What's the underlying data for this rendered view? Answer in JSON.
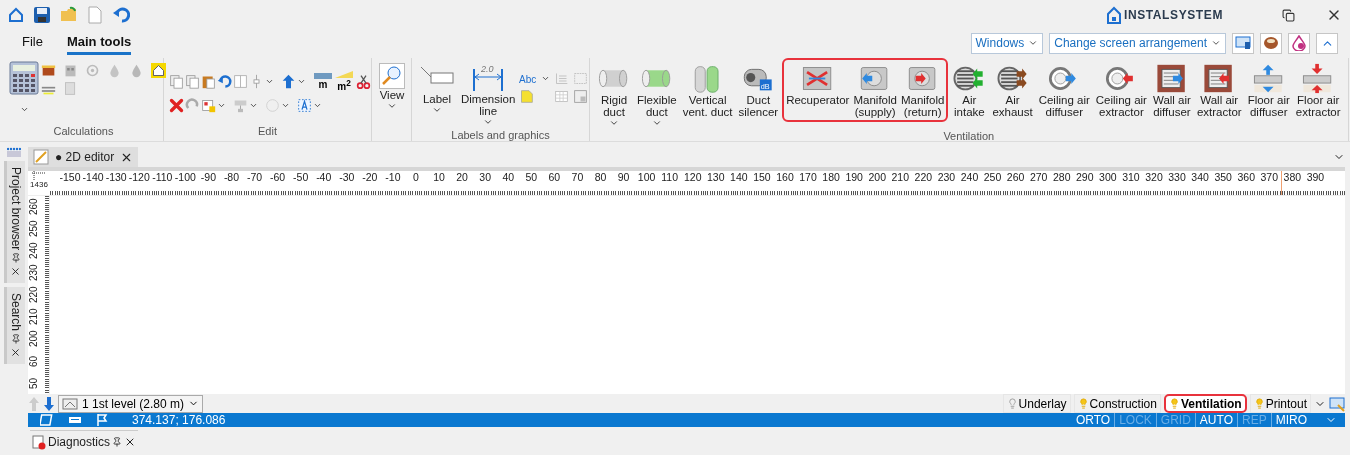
{
  "brand": {
    "name": "INSTALSYSTEM"
  },
  "menu_tabs": [
    {
      "label": "File",
      "selected": false
    },
    {
      "label": "Main tools",
      "selected": true
    }
  ],
  "arrangement": {
    "windows": "Windows",
    "screen": "Change screen arrangement"
  },
  "ribbon": {
    "groups": [
      {
        "kind": "calculations",
        "name": "Calculations"
      },
      {
        "kind": "edit",
        "name": "Edit",
        "icon_texts": [
          "m",
          "m$^{2}$"
        ]
      },
      {
        "kind": "buttons",
        "buttons": [
          {
            "lines": [
              "View"
            ],
            "dropdown": true,
            "highlighted": false
          }
        ]
      },
      {
        "kind": "buttons",
        "name": "Labels and graphics",
        "icon_texts": [
          "Abc"
        ],
        "buttons": [
          {
            "lines": [
              "Label"
            ],
            "dropdown": true,
            "highlighted": false
          },
          {
            "lines": [
              "Dimension",
              "line"
            ],
            "dropdown": true,
            "highlighted": false,
            "icon_text": "2.0"
          }
        ]
      },
      {
        "kind": "buttons",
        "name": "Ventilation",
        "buttons": [
          {
            "lines": [
              "Rigid",
              "duct"
            ],
            "dropdown": true,
            "highlighted": false
          },
          {
            "lines": [
              "Flexible",
              "duct"
            ],
            "dropdown": true,
            "highlighted": false
          },
          {
            "lines": [
              "Vertical",
              "vent. duct"
            ],
            "dropdown": false,
            "highlighted": false
          },
          {
            "lines": [
              "Duct",
              "silencer"
            ],
            "dropdown": false,
            "highlighted": false,
            "icon_text": "dB"
          },
          {
            "lines": [
              "Recuperator"
            ],
            "dropdown": false,
            "highlighted": true
          },
          {
            "lines": [
              "Manifold",
              "(supply)"
            ],
            "dropdown": false,
            "highlighted": true
          },
          {
            "lines": [
              "Manifold",
              "(return)"
            ],
            "dropdown": false,
            "highlighted": true
          },
          {
            "lines": [
              "Air",
              "intake"
            ],
            "dropdown": false,
            "highlighted": false
          },
          {
            "lines": [
              "Air",
              "exhaust"
            ],
            "dropdown": false,
            "highlighted": false
          },
          {
            "lines": [
              "Ceiling air",
              "diffuser"
            ],
            "dropdown": false,
            "highlighted": false
          },
          {
            "lines": [
              "Ceiling air",
              "extractor"
            ],
            "dropdown": false,
            "highlighted": false
          },
          {
            "lines": [
              "Wall air",
              "diffuser"
            ],
            "dropdown": false,
            "highlighted": false
          },
          {
            "lines": [
              "Wall air",
              "extractor"
            ],
            "dropdown": false,
            "highlighted": false
          },
          {
            "lines": [
              "Floor air",
              "diffuser"
            ],
            "dropdown": false,
            "highlighted": false
          },
          {
            "lines": [
              "Floor air",
              "extractor"
            ],
            "dropdown": false,
            "highlighted": false
          }
        ]
      }
    ]
  },
  "side_panels": [
    {
      "label": "Project browser"
    },
    {
      "label": "Search"
    }
  ],
  "doc_tabs": [
    {
      "label": "● 2D editor",
      "selected": true
    }
  ],
  "ruler": {
    "corner": "1436",
    "x_labels": [
      "-150",
      "-140",
      "-130",
      "-120",
      "-110",
      "-100",
      "-90",
      "-80",
      "-70",
      "-60",
      "-50",
      "-40",
      "-30",
      "-20",
      "-10",
      "0",
      "10",
      "20",
      "30",
      "40",
      "50",
      "60",
      "70",
      "80",
      "90",
      "100",
      "110",
      "120",
      "130",
      "140",
      "150",
      "160",
      "170",
      "180",
      "190",
      "200",
      "210",
      "220",
      "230",
      "240",
      "250",
      "260",
      "270",
      "280",
      "290",
      "300",
      "310",
      "320",
      "330",
      "340",
      "350",
      "360",
      "370",
      "380",
      "390"
    ],
    "y_labels": [
      "260",
      "250",
      "240",
      "230",
      "220",
      "210",
      "200",
      "60",
      "50"
    ]
  },
  "level_bar": {
    "level": "1 1st level (2.80 m)",
    "layers": [
      {
        "label": "Underlay",
        "lit": false,
        "selected": false,
        "highlighted": false
      },
      {
        "label": "Construction",
        "lit": true,
        "selected": false,
        "highlighted": false
      },
      {
        "label": "Ventilation",
        "lit": true,
        "selected": true,
        "highlighted": true
      },
      {
        "label": "Printout",
        "lit": true,
        "selected": false,
        "highlighted": false
      }
    ]
  },
  "status_bar": {
    "coords": "374.137; 176.086",
    "modes": [
      {
        "label": "ORTO",
        "on": true
      },
      {
        "label": "LOCK",
        "on": false
      },
      {
        "label": "GRID",
        "on": false
      },
      {
        "label": "AUTO",
        "on": true
      },
      {
        "label": "REP",
        "on": false
      },
      {
        "label": "MIRO",
        "on": true
      }
    ]
  },
  "bottom_panels": [
    {
      "label": "Diagnostics"
    }
  ]
}
